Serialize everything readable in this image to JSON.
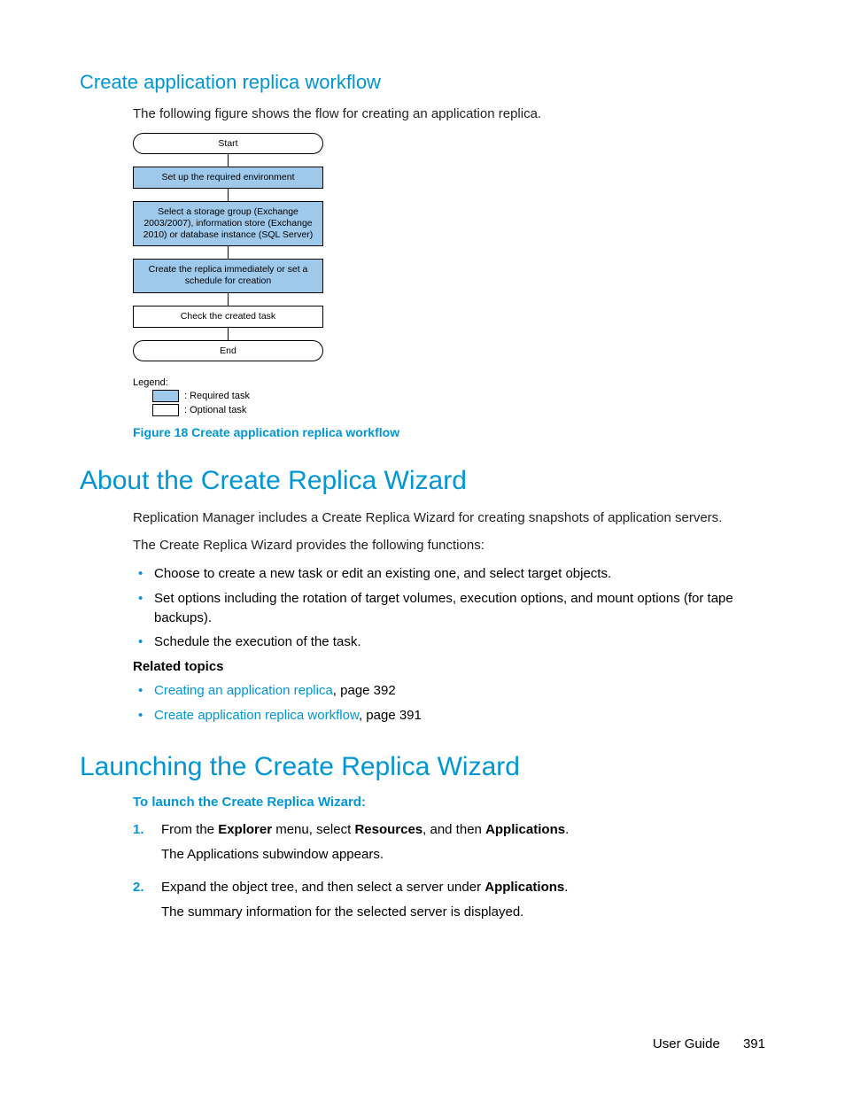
{
  "section1": {
    "heading": "Create application replica workflow",
    "intro": "The following figure shows the flow for creating an application replica."
  },
  "flow": {
    "start": "Start",
    "step1": "Set up the required environment",
    "step2": "Select a storage group (Exchange 2003/2007), information store (Exchange 2010) or database instance (SQL Server)",
    "step3": "Create the replica immediately or set a schedule for creation",
    "step4": "Check the created task",
    "end": "End"
  },
  "legend": {
    "title": "Legend:",
    "req": ": Required task",
    "opt": ": Optional task"
  },
  "figcaption": "Figure 18 Create application replica workflow",
  "section2": {
    "heading": "About the Create Replica Wizard",
    "p1": "Replication Manager includes a Create Replica Wizard for creating snapshots of application servers.",
    "p2": "The Create Replica Wizard provides the following functions:",
    "bullets": {
      "b1": "Choose to create a new task or edit an existing one, and select target objects.",
      "b2": "Set options including the rotation of target volumes, execution options, and mount options (for tape backups).",
      "b3": "Schedule the execution of the task."
    },
    "related_label": "Related topics",
    "related": {
      "r1_link": "Creating an application replica",
      "r1_tail": ", page 392",
      "r2_link": "Create application replica workflow",
      "r2_tail": ", page 391"
    }
  },
  "section3": {
    "heading": "Launching the Create Replica Wizard",
    "proc_title": "To launch the Create Replica Wizard:",
    "steps": {
      "s1_a": "From the ",
      "s1_b": "Explorer",
      "s1_c": " menu, select ",
      "s1_d": "Resources",
      "s1_e": ", and then ",
      "s1_f": "Applications",
      "s1_g": ".",
      "s1_sub": "The Applications subwindow appears.",
      "s2_a": "Expand the object tree, and then select a server under ",
      "s2_b": "Applications",
      "s2_c": ".",
      "s2_sub": "The summary information for the selected server is displayed."
    }
  },
  "footer": {
    "doc": "User Guide",
    "page": "391"
  }
}
